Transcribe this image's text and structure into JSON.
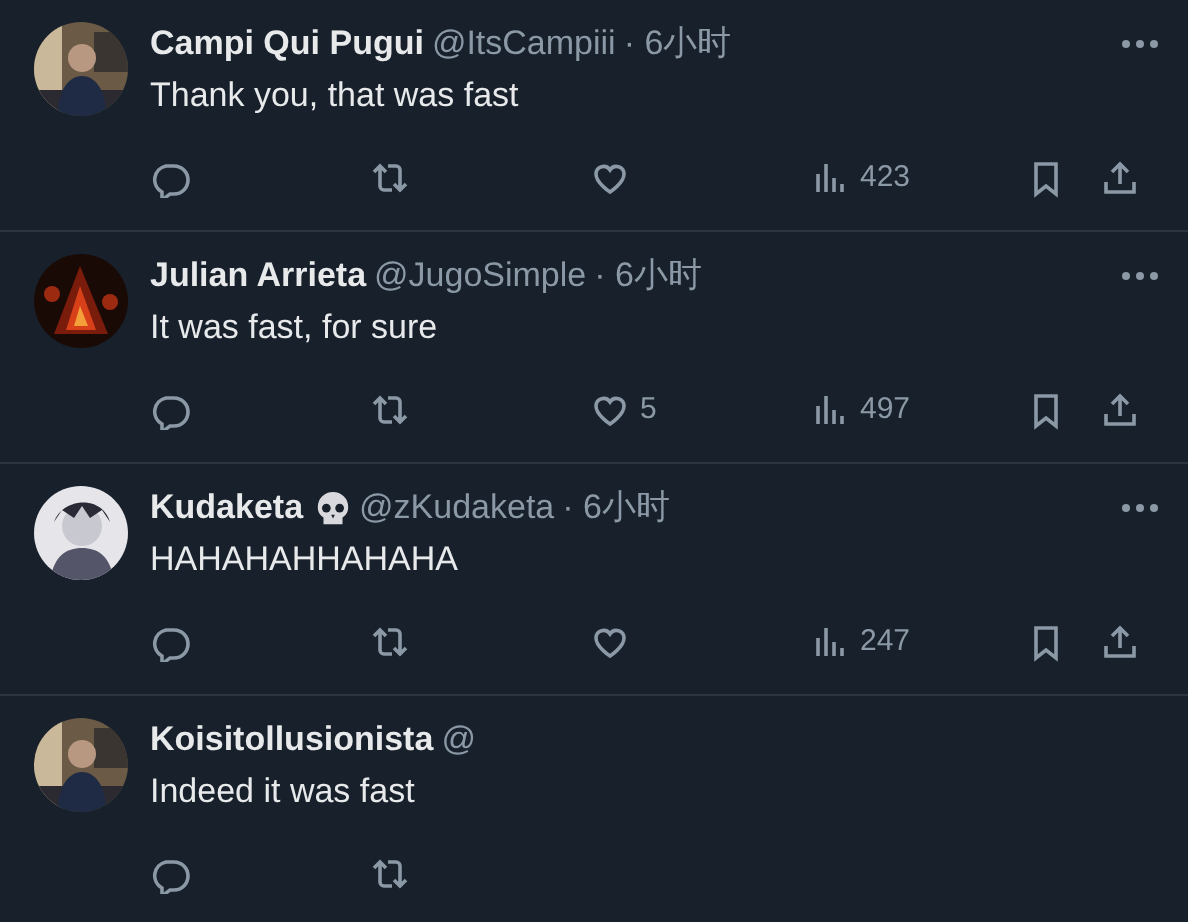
{
  "tweets": [
    {
      "name": "Campi Qui Pugui",
      "handle": "@ItsCampiii",
      "time": "· 6小时",
      "text": "Thank you, that was fast",
      "more": true,
      "actions": [
        {
          "kind": "reply"
        },
        {
          "kind": "repost"
        },
        {
          "kind": "like"
        },
        {
          "kind": "views",
          "count": "423"
        },
        {
          "kind": "bookmark"
        },
        {
          "kind": "share"
        }
      ]
    },
    {
      "name": "Julian Arrieta",
      "handle": "@JugoSimple",
      "time": "· 6小时",
      "text": "It was fast, for sure",
      "more": true,
      "actions": [
        {
          "kind": "reply"
        },
        {
          "kind": "repost"
        },
        {
          "kind": "like",
          "count": "5"
        },
        {
          "kind": "views",
          "count": "497"
        },
        {
          "kind": "bookmark"
        },
        {
          "kind": "share"
        }
      ]
    },
    {
      "name": "Kudaketa",
      "skull_emoji": true,
      "handle": "@zKudaketa",
      "time": "· 6小时",
      "text": "HAHAHAHHAHAHA",
      "more": true,
      "actions": [
        {
          "kind": "reply"
        },
        {
          "kind": "repost"
        },
        {
          "kind": "like"
        },
        {
          "kind": "views",
          "count": "247"
        },
        {
          "kind": "bookmark"
        },
        {
          "kind": "share"
        }
      ]
    },
    {
      "name": "Koisitollusionista",
      "handle": "@",
      "text": "Indeed it was fast",
      "more": false,
      "actions": [
        {
          "kind": "reply"
        },
        {
          "kind": "repost"
        }
      ]
    }
  ]
}
